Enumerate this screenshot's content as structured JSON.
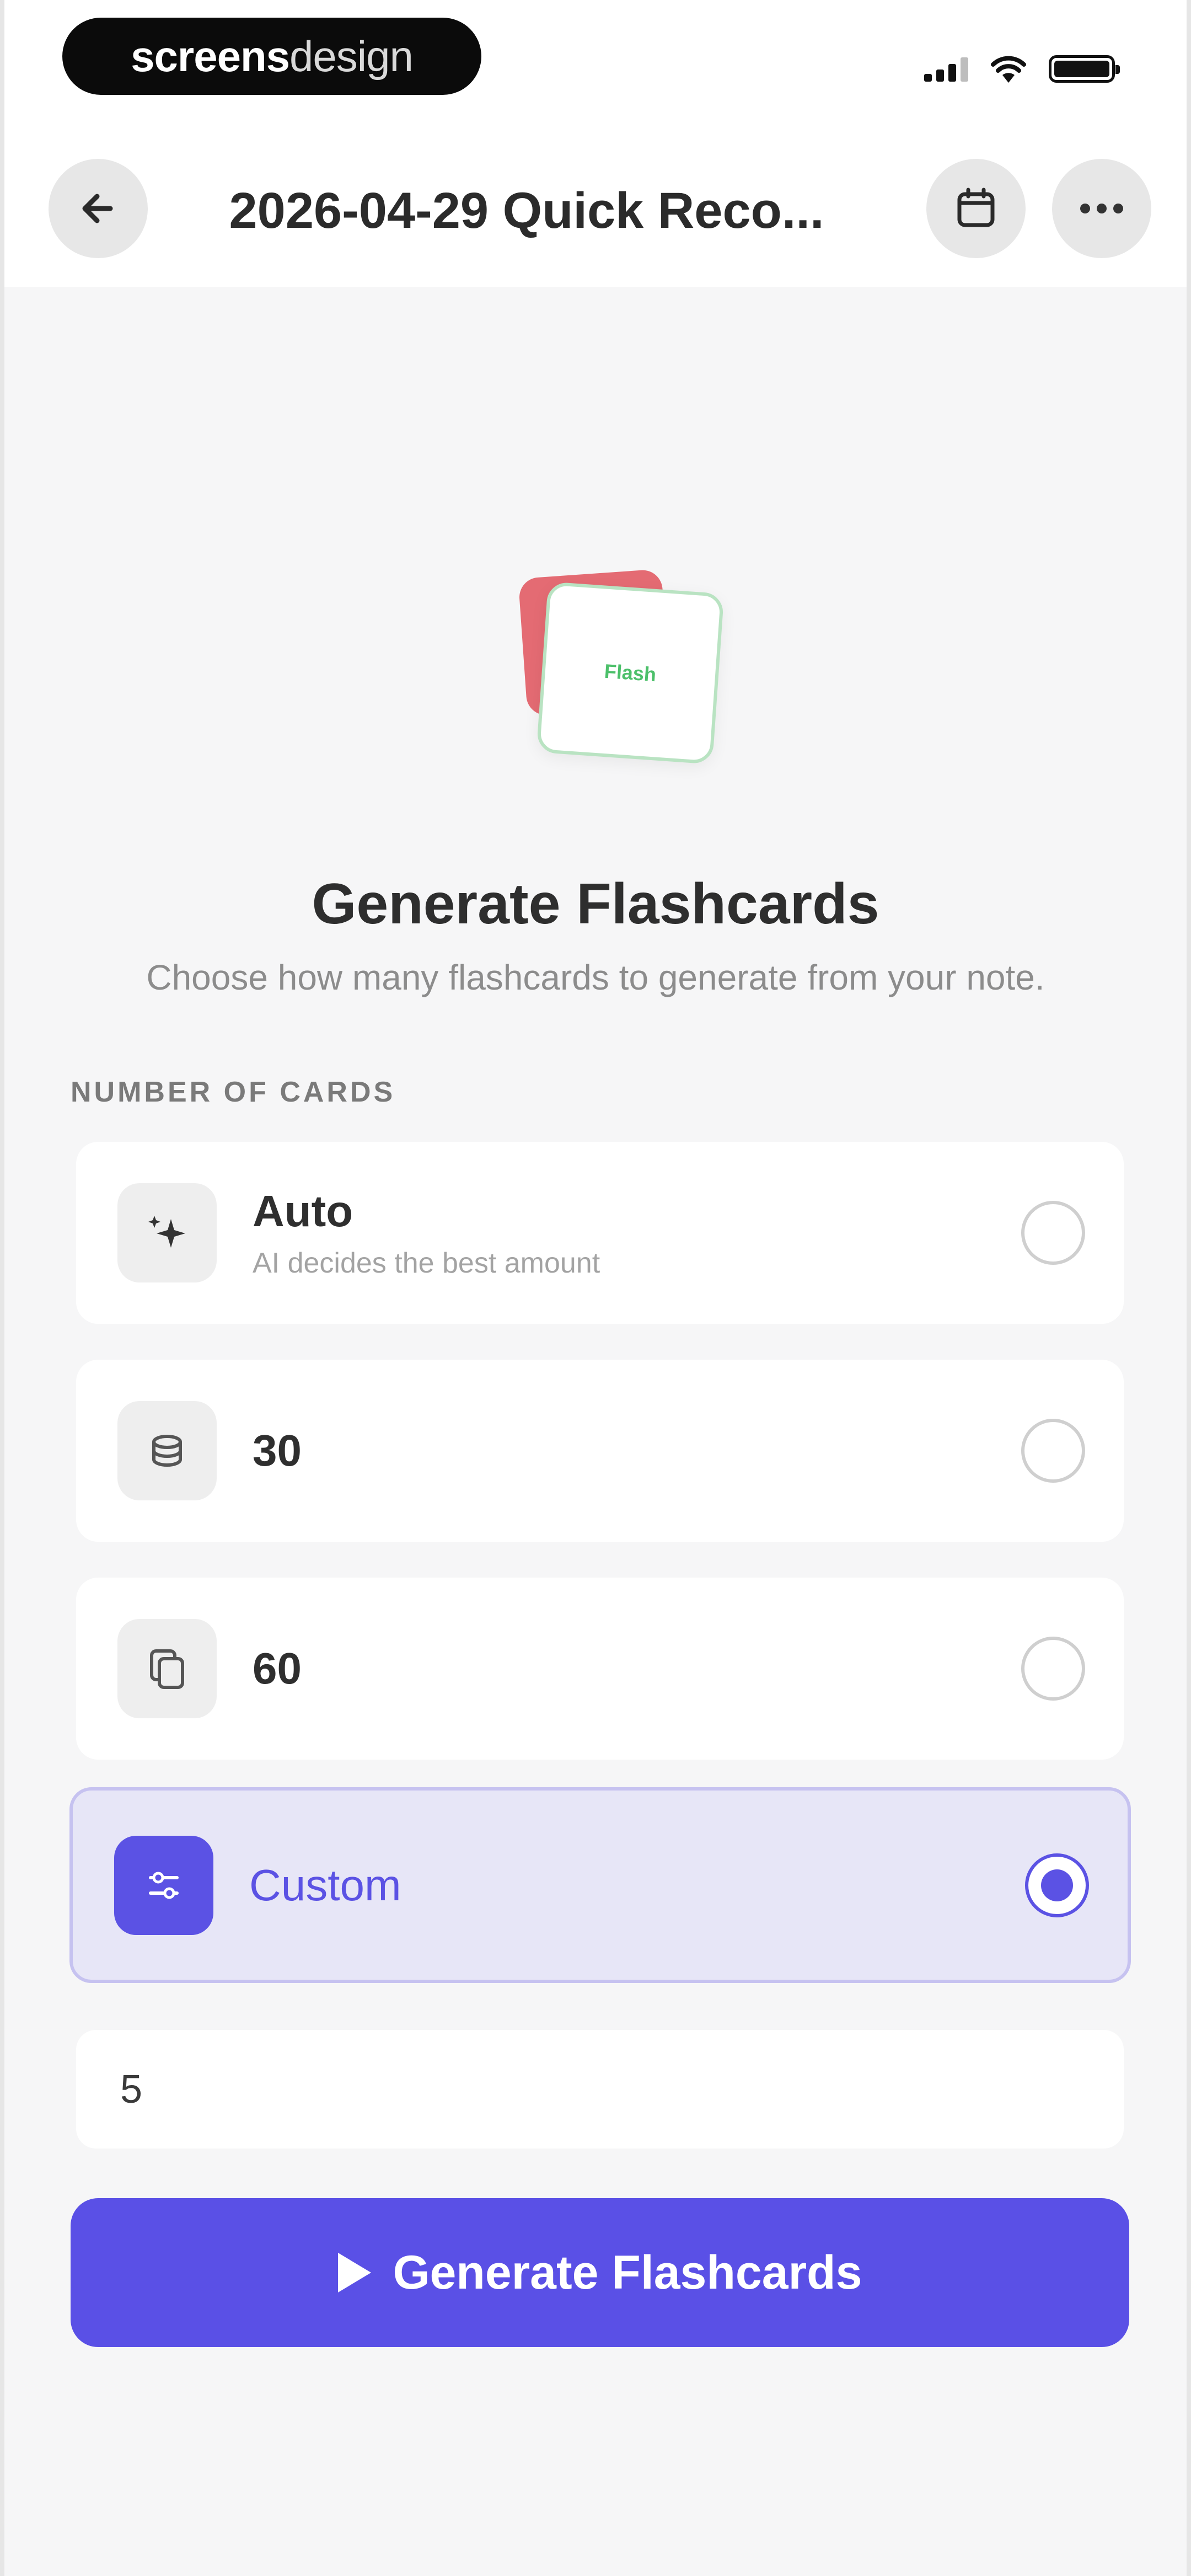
{
  "status_bar": {
    "brand_bold": "screens",
    "brand_light": "design"
  },
  "header": {
    "title": "2026-04-29 Quick Reco..."
  },
  "illustration": {
    "card_text": "Flash"
  },
  "main": {
    "heading": "Generate Flashcards",
    "subtitle": "Choose how many flashcards to generate from your note.",
    "section_label": "NUMBER OF CARDS",
    "options": [
      {
        "label": "Auto",
        "sub": "AI decides the best amount",
        "selected": false
      },
      {
        "label": "30",
        "selected": false
      },
      {
        "label": "60",
        "selected": false
      },
      {
        "label": "Custom",
        "selected": true
      }
    ],
    "custom_value": "5",
    "generate_label": "Generate Flashcards"
  },
  "colors": {
    "accent": "#5a50e6",
    "selected_bg": "#e7e6f7",
    "card_red": "#e46b73",
    "card_green": "#4cc06a"
  },
  "icons": {
    "back": "arrow-left-icon",
    "calendar": "calendar-icon",
    "more": "more-horizontal-icon",
    "auto": "sparkle-icon",
    "thirty": "stack-icon",
    "sixty": "copy-icon",
    "custom": "sliders-icon",
    "generate": "play-icon"
  }
}
